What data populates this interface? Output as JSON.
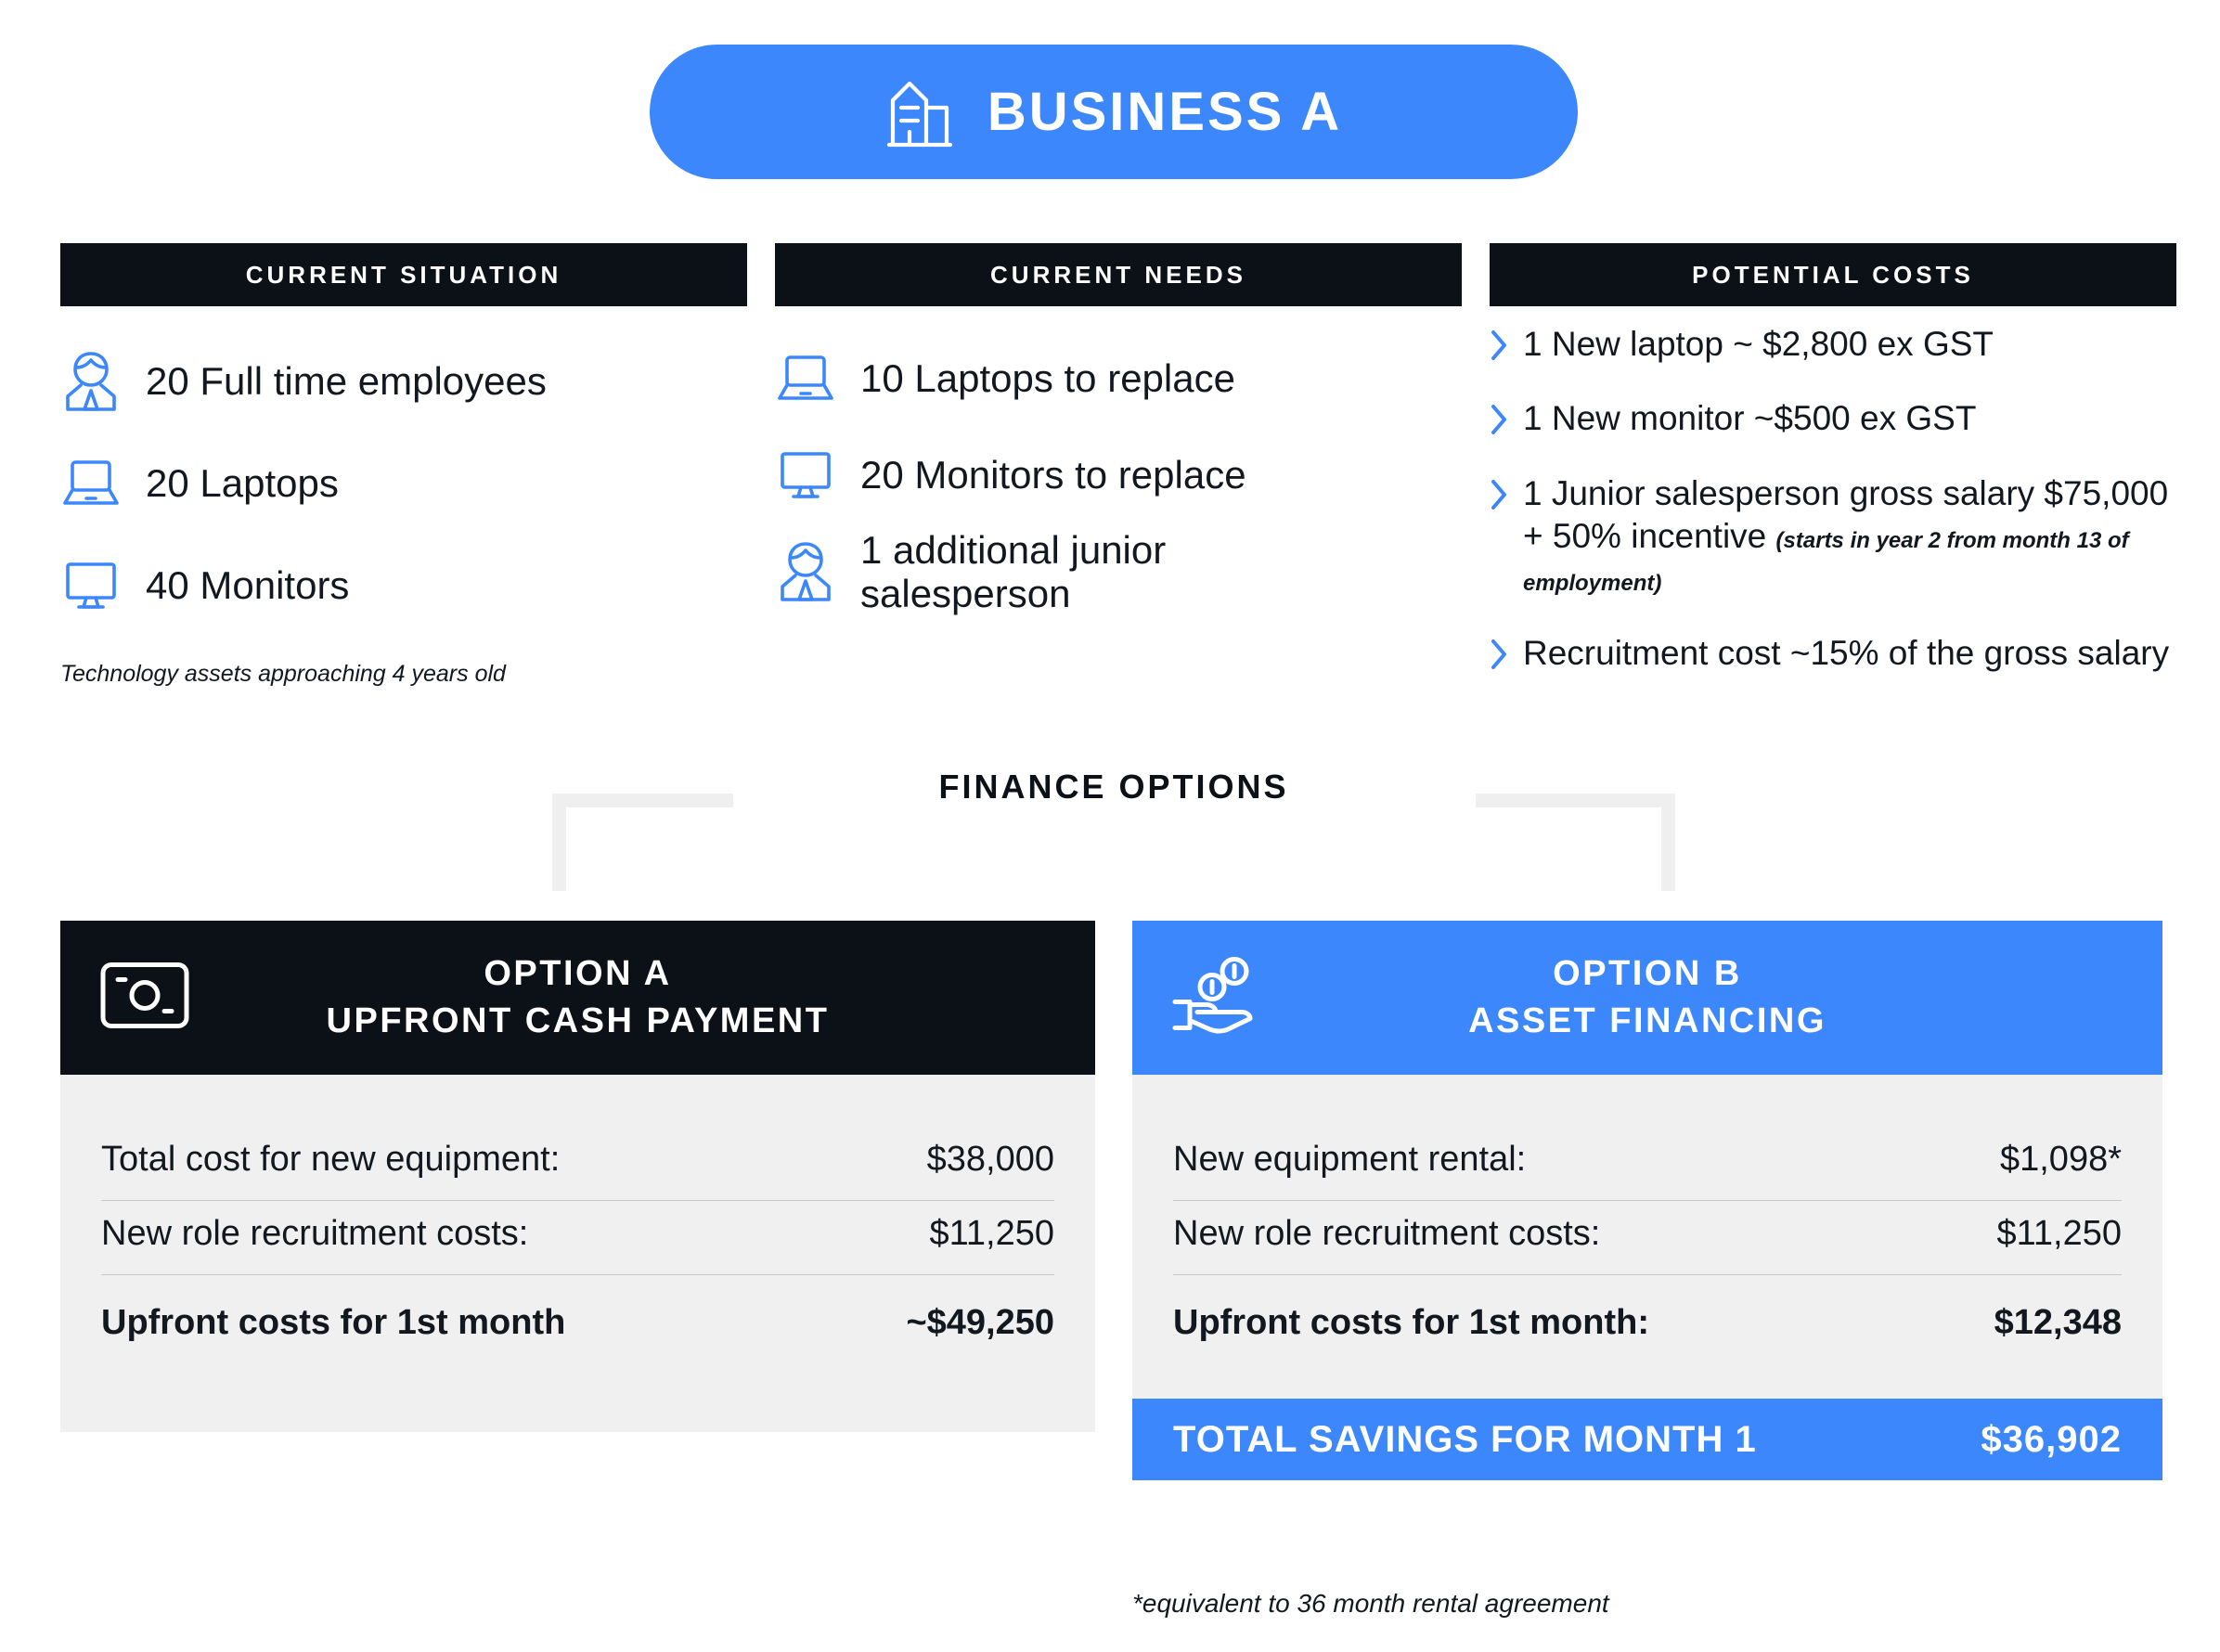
{
  "title": {
    "label": "BUSINESS A",
    "icon": "building-icon",
    "pill_color": "#3b87fb"
  },
  "columns": [
    {
      "heading": "CURRENT SITUATION",
      "items": [
        {
          "icon": "person-icon",
          "text": "20 Full time employees"
        },
        {
          "icon": "laptop-icon",
          "text": "20 Laptops"
        },
        {
          "icon": "monitor-icon",
          "text": "40 Monitors"
        }
      ],
      "note": "Technology assets approaching 4 years old"
    },
    {
      "heading": "CURRENT NEEDS",
      "items": [
        {
          "icon": "laptop-icon",
          "text": "10 Laptops to replace"
        },
        {
          "icon": "monitor-icon",
          "text": "20 Monitors to replace"
        },
        {
          "icon": "person-icon",
          "text": "1 additional junior salesperson"
        }
      ]
    },
    {
      "heading": "POTENTIAL COSTS",
      "bullets": [
        {
          "text": "1 New laptop ~ $2,800 ex GST",
          "note": ""
        },
        {
          "text": "1 New monitor ~$500 ex GST",
          "note": ""
        },
        {
          "text": "1 Junior salesperson gross salary $75,000 + 50% incentive",
          "note": "(starts in year 2 from month 13 of employment)"
        },
        {
          "text": "Recruitment cost ~15% of the gross salary",
          "note": ""
        }
      ]
    }
  ],
  "divider": {
    "label": "FINANCE OPTIONS",
    "color": "#efefef"
  },
  "option_a": {
    "icon": "banknote-icon",
    "title_line1": "OPTION A",
    "title_line2": "UPFRONT CASH PAYMENT",
    "header_color": "#0b1117",
    "rows": [
      {
        "label": "Total cost for new equipment:",
        "value": "$38,000",
        "bold": false
      },
      {
        "label": "New role recruitment costs:",
        "value": "$11,250",
        "bold": false
      },
      {
        "label": "Upfront costs for 1st month",
        "value": "~$49,250",
        "bold": true
      }
    ]
  },
  "option_b": {
    "icon": "hand-coins-icon",
    "title_line1": "OPTION B",
    "title_line2": "ASSET FINANCING",
    "header_color": "#3b87fb",
    "rows": [
      {
        "label": "New equipment rental:",
        "value": "$1,098*",
        "bold": false
      },
      {
        "label": "New role recruitment costs:",
        "value": "$11,250",
        "bold": false
      },
      {
        "label": "Upfront costs for 1st month:",
        "value": "$12,348",
        "bold": true
      }
    ],
    "savings_label": "TOTAL SAVINGS FOR MONTH 1",
    "savings_value": "$36,902",
    "savings_color": "#3b87fb",
    "footnote": "*equivalent to 36 month rental agreement"
  }
}
